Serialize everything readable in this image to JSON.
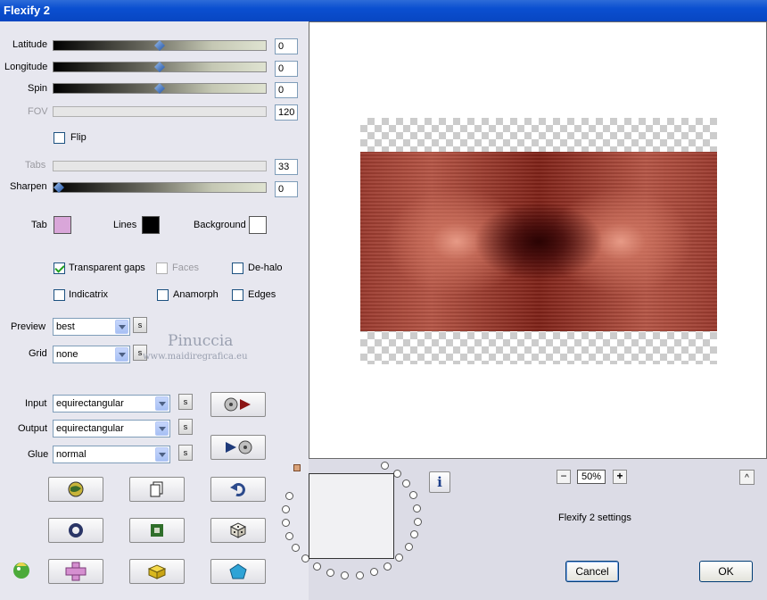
{
  "window": {
    "title": "Flexify 2"
  },
  "sliders": [
    {
      "label": "Latitude",
      "value": "0",
      "disabled": false,
      "thumb": 0.5
    },
    {
      "label": "Longitude",
      "value": "0",
      "disabled": false,
      "thumb": 0.5
    },
    {
      "label": "Spin",
      "value": "0",
      "disabled": false,
      "thumb": 0.5
    },
    {
      "label": "FOV",
      "value": "120",
      "disabled": true,
      "thumb": null
    },
    {
      "label": "Tabs",
      "value": "33",
      "disabled": true,
      "thumb": null
    },
    {
      "label": "Sharpen",
      "value": "0",
      "disabled": false,
      "thumb": 0
    }
  ],
  "flip": {
    "label": "Flip",
    "checked": false
  },
  "colors": {
    "tab": {
      "label": "Tab",
      "color": "#d9a6d9"
    },
    "lines": {
      "label": "Lines",
      "color": "#000000"
    },
    "background": {
      "label": "Background",
      "color": "#ffffff"
    }
  },
  "checkboxes": [
    {
      "label": "Transparent gaps",
      "checked": true,
      "disabled": false
    },
    {
      "label": "Faces",
      "checked": false,
      "disabled": true
    },
    {
      "label": "De-halo",
      "checked": false,
      "disabled": false
    },
    {
      "label": "Indicatrix",
      "checked": false,
      "disabled": false
    },
    {
      "label": "Anamorph",
      "checked": false,
      "disabled": false
    },
    {
      "label": "Edges",
      "checked": false,
      "disabled": false
    }
  ],
  "preview": {
    "label": "Preview",
    "value": "best"
  },
  "grid": {
    "label": "Grid",
    "value": "none"
  },
  "input": {
    "label": "Input",
    "value": "equirectangular"
  },
  "output": {
    "label": "Output",
    "value": "equirectangular"
  },
  "glue": {
    "label": "Glue",
    "value": "normal"
  },
  "s_label": "s",
  "watermark": {
    "line1": "Pinuccia",
    "line2": "www.maidiregrafica.eu"
  },
  "zoom": {
    "value": "50%",
    "minus": "−",
    "plus": "+"
  },
  "status": "Flexify 2 settings",
  "collapse": "^",
  "buttons": {
    "cancel": "Cancel",
    "ok": "OK"
  }
}
